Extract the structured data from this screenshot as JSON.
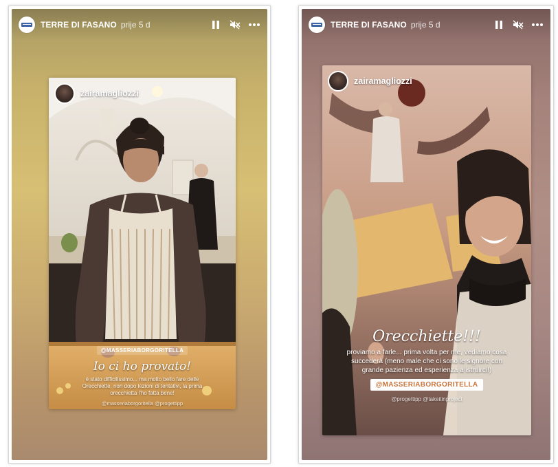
{
  "stories": [
    {
      "account": "TERRE DI FASANO",
      "time": "prije 5 d",
      "reshared": {
        "username": "zairamagliozzi",
        "mention": "@MASSERIABORGORITELLA",
        "title": "Io ci ho provato!",
        "body": "è stato difficilissimo... ma molto bello fare delle Orecchiette, non dopo lezioni di tentativi, la prima orecchietta l'ho fatta bene!",
        "hashtags": "@masseriaborgoritella @progettipp"
      }
    },
    {
      "account": "TERRE DI FASANO",
      "time": "prije 5 d",
      "reshared": {
        "username": "zairamagliozzi",
        "title": "Orecchiette!!!",
        "body": "proviamo a farle... prima volta per me, vediamo cosa succederà (meno male che ci sono le signore con grande pazienza ed esperienza a istruirci!)",
        "mention": "@MASSERIABORGORITELLA",
        "hashtags": "@progettipp @takeitinproject"
      }
    }
  ],
  "icons": {
    "pause": "pause-icon",
    "mute": "speaker-muted-icon",
    "more": "more-options-icon"
  },
  "colors": {
    "left_background": "#c8b26b",
    "right_background": "#a5827b",
    "mention_text": "#c9743b"
  }
}
